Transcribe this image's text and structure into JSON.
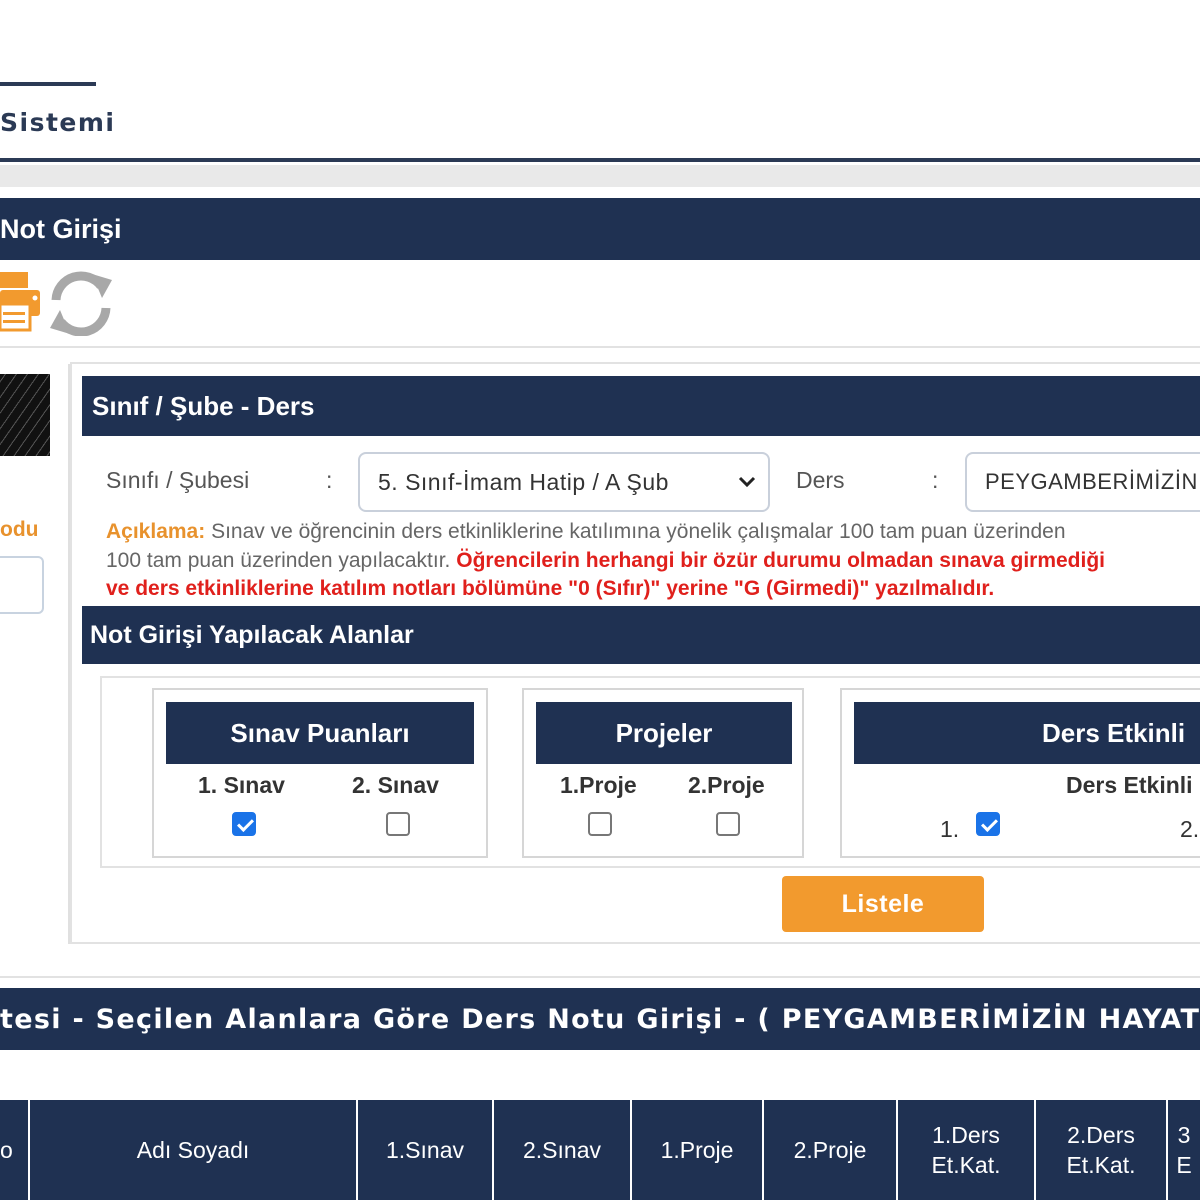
{
  "header": {
    "system_title": "Sistemi"
  },
  "main_bar": {
    "title": "Not Girişi"
  },
  "toolbar": {
    "print_icon": "printer-icon",
    "refresh_icon": "refresh-icon"
  },
  "left_panel": {
    "label": "odu"
  },
  "section_class": {
    "title": "Sınıf / Şube  - Ders",
    "class_label": "Sınıfı / Şubesi",
    "colon": ":",
    "class_value": "5. Sınıf-İmam Hatip / A Şub",
    "course_label": "Ders",
    "course_value": "PEYGAMBERİMİZİN"
  },
  "note": {
    "prefix": "Açıklama:",
    "line1": "Sınav ve öğrencinin ders etkinliklerine katılımına yönelik çalışmalar 100 tam puan üzerinden",
    "line2_gray": "100 tam puan üzerinden yapılacaktır.",
    "line2_red": "Öğrencilerin herhangi bir özür durumu olmadan sınava girmediği",
    "line3_red": "ve ders etkinliklerine katılım notları bölümüne \"0 (Sıfır)\" yerine \"G (Girmedi)\" yazılmalıdır."
  },
  "fields": {
    "title": "Not Girişi Yapılacak Alanlar",
    "groups": [
      {
        "title": "Sınav Puanları",
        "items": [
          {
            "label": "1. Sınav",
            "checked": true
          },
          {
            "label": "2. Sınav",
            "checked": false
          }
        ]
      },
      {
        "title": "Projeler",
        "items": [
          {
            "label": "1.Proje",
            "checked": false
          },
          {
            "label": "2.Proje",
            "checked": false
          }
        ]
      },
      {
        "title": "Ders Etkinli",
        "subtitle": "Ders Etkinli",
        "items": [
          {
            "label": "1.",
            "checked": true
          },
          {
            "label": "2."
          }
        ]
      }
    ]
  },
  "list_button": {
    "label": "Listele"
  },
  "list_bar": {
    "title": "tesi - Seçilen Alanlara Göre Ders Notu Girişi - ( PEYGAMBERİMİZİN HAYATI"
  },
  "table": {
    "headers": [
      "o",
      "Adı Soyadı",
      "1.Sınav",
      "2.Sınav",
      "1.Proje",
      "2.Proje",
      "1.Ders Et.Kat.",
      "2.Ders Et.Kat.",
      "3 E"
    ]
  },
  "colors": {
    "navy": "#1f3152",
    "orange": "#f29a2e",
    "red": "#e0201c",
    "checkbox": "#1a73e8"
  }
}
